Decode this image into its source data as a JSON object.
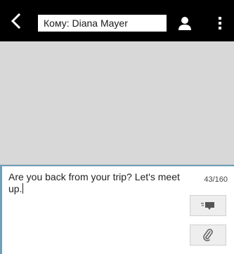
{
  "header": {
    "recipient_field_text": "Кому: Diana Mayer",
    "back_icon": "chevron-left-icon",
    "contact_icon": "person-icon",
    "menu_icon": "overflow-menu-icon"
  },
  "compose": {
    "message_text": "Are you back from your trip? Let's meet up.",
    "char_counter": "43/160",
    "send_icon": "send-icon",
    "attach_icon": "paperclip-icon"
  },
  "colors": {
    "topbar": "#000000",
    "thread_background": "#d8d8d8",
    "compose_accent": "#6f9fb6"
  }
}
